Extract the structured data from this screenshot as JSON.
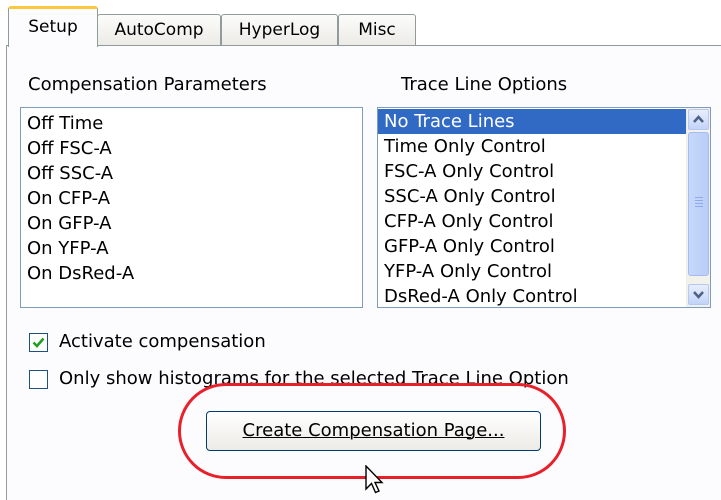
{
  "tabs": [
    {
      "label": "Setup",
      "active": true
    },
    {
      "label": "AutoComp"
    },
    {
      "label": "HyperLog"
    },
    {
      "label": "Misc"
    }
  ],
  "compensation": {
    "heading": "Compensation Parameters",
    "rows": [
      "Off  Time",
      "Off  FSC-A",
      "Off  SSC-A",
      "On  CFP-A",
      "On  GFP-A",
      "On  YFP-A",
      "On  DsRed-A"
    ]
  },
  "trace": {
    "heading": "Trace Line Options",
    "selected_index": 0,
    "rows": [
      "No Trace Lines",
      "Time Only Control",
      "FSC-A Only Control",
      "SSC-A Only Control",
      "CFP-A Only Control",
      "GFP-A Only Control",
      "YFP-A Only Control",
      "DsRed-A Only Control"
    ]
  },
  "checkboxes": {
    "activate": {
      "label": "Activate compensation",
      "checked": true
    },
    "histograms": {
      "label": "Only show histograms for the selected Trace Line Option",
      "checked": false
    }
  },
  "create_button": {
    "label": "Create Compensation Page..."
  },
  "colors": {
    "accent": "#316ac5",
    "highlight": "#e8202a",
    "tab_hot": "#ffc83c"
  }
}
